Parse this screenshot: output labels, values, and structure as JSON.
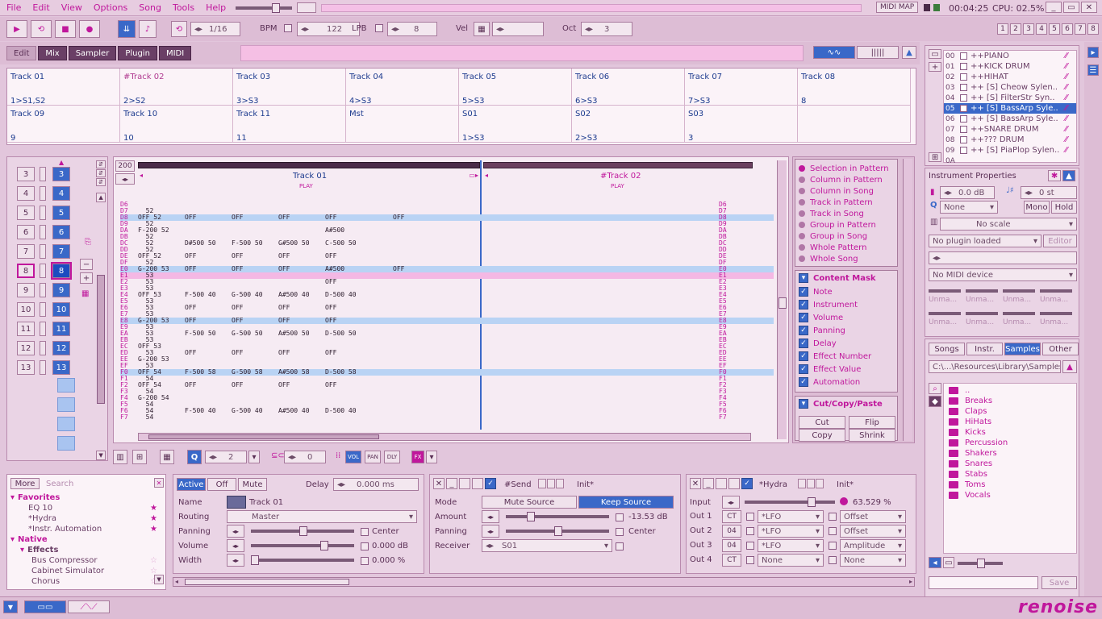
{
  "menu": [
    "File",
    "Edit",
    "View",
    "Options",
    "Song",
    "Tools",
    "Help"
  ],
  "top": {
    "midi_map": "MIDI MAP",
    "time": "00:04:25",
    "cpu": "CPU: 02.5%"
  },
  "transport": {
    "quant": "1/16",
    "bpm_label": "BPM",
    "bpm": "122",
    "lpb_label": "LPB",
    "lpb": "8",
    "vel_label": "Vel",
    "oct_label": "Oct",
    "oct": "3",
    "edit_steps": [
      "1",
      "2",
      "3",
      "4",
      "5",
      "6",
      "7",
      "8"
    ]
  },
  "tabs": [
    "Edit",
    "Mix",
    "Sampler",
    "Plugin",
    "MIDI"
  ],
  "instruments": [
    {
      "num": "00",
      "name": "++PIANO"
    },
    {
      "num": "01",
      "name": "++KICK DRUM"
    },
    {
      "num": "02",
      "name": "++HIHAT"
    },
    {
      "num": "03",
      "name": "++ [S] Cheow Sylen.."
    },
    {
      "num": "04",
      "name": "++ [S] FilterStr Syn.."
    },
    {
      "num": "05",
      "name": "++ [S] BassArp Syle.."
    },
    {
      "num": "06",
      "name": "++ [S] BassArp Syle.."
    },
    {
      "num": "07",
      "name": "++SNARE DRUM"
    },
    {
      "num": "08",
      "name": "++??? DRUM"
    },
    {
      "num": "09",
      "name": "++ [S] PiaPlop Sylen.."
    },
    {
      "num": "0A",
      "name": ""
    }
  ],
  "grid": {
    "row1": [
      [
        "Track 01",
        "1>S1,S2"
      ],
      [
        "#Track 02",
        "2>S2"
      ],
      [
        "Track 03",
        "3>S3"
      ],
      [
        "Track 04",
        "4>S3"
      ],
      [
        "Track 05",
        "5>S3"
      ],
      [
        "Track 06",
        "6>S3"
      ],
      [
        "Track 07",
        "7>S3"
      ],
      [
        "Track 08",
        "8"
      ]
    ],
    "row2": [
      [
        "Track 09",
        "9"
      ],
      [
        "Track 10",
        "10"
      ],
      [
        "Track 11",
        "11"
      ],
      [
        "Mst",
        ""
      ],
      [
        "S01",
        "1>S3"
      ],
      [
        "S02",
        "2>S3"
      ],
      [
        "S03",
        "3"
      ],
      [
        "",
        ""
      ]
    ]
  },
  "seq": {
    "left": [
      "3",
      "4",
      "5",
      "6",
      "7",
      "8",
      "9",
      "10",
      "11",
      "12",
      "13"
    ],
    "right": [
      "3",
      "4",
      "5",
      "6",
      "7",
      "8",
      "9",
      "10",
      "11",
      "12",
      "13"
    ],
    "len": "200"
  },
  "pattern": {
    "track1": "Track 01",
    "track2": "#Track 02",
    "play": "PLAY",
    "rows": [
      [
        "D6",
        "",
        "",
        "",
        "",
        "",
        "",
        "D6"
      ],
      [
        "D7",
        "  52",
        "",
        "",
        "",
        "",
        "",
        "D7"
      ],
      [
        "D8",
        "OFF 52",
        "OFF",
        "OFF",
        "OFF",
        "OFF",
        "OFF",
        "D8"
      ],
      [
        "D9",
        "  52",
        "",
        "",
        "",
        "",
        "",
        "D9"
      ],
      [
        "DA",
        "F-200 52",
        "",
        "",
        "",
        "A#500",
        "",
        "DA"
      ],
      [
        "DB",
        "  52",
        "",
        "",
        "",
        "",
        "",
        "DB"
      ],
      [
        "DC",
        "  52",
        "D#500 50",
        "F-500 50",
        "G#500 50",
        "C-500 50",
        "",
        "DC"
      ],
      [
        "DD",
        "  52",
        "",
        "",
        "",
        "",
        "",
        "DD"
      ],
      [
        "DE",
        "OFF 52",
        "OFF",
        "OFF",
        "OFF",
        "OFF",
        "",
        "DE"
      ],
      [
        "DF",
        "  52",
        "",
        "",
        "",
        "",
        "",
        "DF"
      ],
      [
        "E0",
        "G-200 53",
        "OFF",
        "OFF",
        "OFF",
        "A#500",
        "OFF",
        "E0"
      ],
      [
        "E1",
        "  53",
        "",
        "",
        "",
        "",
        "",
        "E1"
      ],
      [
        "E2",
        "  53",
        "",
        "",
        "",
        "OFF",
        "",
        "E2"
      ],
      [
        "E3",
        "  53",
        "",
        "",
        "",
        "",
        "",
        "E3"
      ],
      [
        "E4",
        "OFF 53",
        "F-500 40",
        "G-500 40",
        "A#500 40",
        "D-500 40",
        "",
        "E4"
      ],
      [
        "E5",
        "  53",
        "",
        "",
        "",
        "",
        "",
        "E5"
      ],
      [
        "E6",
        "  53",
        "OFF",
        "OFF",
        "OFF",
        "OFF",
        "",
        "E6"
      ],
      [
        "E7",
        "  53",
        "",
        "",
        "",
        "",
        "",
        "E7"
      ],
      [
        "E8",
        "G-200 53",
        "OFF",
        "OFF",
        "OFF",
        "OFF",
        "",
        "E8"
      ],
      [
        "E9",
        "  53",
        "",
        "",
        "",
        "",
        "",
        "E9"
      ],
      [
        "EA",
        "  53",
        "F-500 50",
        "G-500 50",
        "A#500 50",
        "D-500 50",
        "",
        "EA"
      ],
      [
        "EB",
        "  53",
        "",
        "",
        "",
        "",
        "",
        "EB"
      ],
      [
        "EC",
        "OFF 53",
        "",
        "",
        "",
        "",
        "",
        "EC"
      ],
      [
        "ED",
        "  53",
        "OFF",
        "OFF",
        "OFF",
        "OFF",
        "",
        "ED"
      ],
      [
        "EE",
        "G-200 53",
        "",
        "",
        "",
        "",
        "",
        "EE"
      ],
      [
        "EF",
        "  53",
        "",
        "",
        "",
        "",
        "",
        "EF"
      ],
      [
        "F0",
        "OFF 54",
        "F-500 58",
        "G-500 58",
        "A#500 58",
        "D-500 58",
        "",
        "F0"
      ],
      [
        "F1",
        "  54",
        "",
        "",
        "",
        "",
        "",
        "F1"
      ],
      [
        "F2",
        "OFF 54",
        "OFF",
        "OFF",
        "OFF",
        "OFF",
        "",
        "F2"
      ],
      [
        "F3",
        "  54",
        "",
        "",
        "",
        "",
        "",
        "F3"
      ],
      [
        "F4",
        "G-200 54",
        "",
        "",
        "",
        "",
        "",
        "F4"
      ],
      [
        "F5",
        "  54",
        "",
        "",
        "",
        "",
        "",
        "F5"
      ],
      [
        "F6",
        "  54",
        "F-500 40",
        "G-500 40",
        "A#500 40",
        "D-500 40",
        "",
        "F6"
      ],
      [
        "F7",
        "  54",
        "",
        "",
        "",
        "",
        "",
        "F7"
      ]
    ]
  },
  "scope": [
    "Selection in Pattern",
    "Column in Pattern",
    "Column in Song",
    "Track in Pattern",
    "Track in Song",
    "Group in Pattern",
    "Group in Song",
    "Whole Pattern",
    "Whole Song"
  ],
  "mask": {
    "title": "Content Mask",
    "items": [
      "Note",
      "Instrument",
      "Volume",
      "Panning",
      "Delay",
      "Effect Number",
      "Effect Value",
      "Automation"
    ]
  },
  "ccp": {
    "title": "Cut/Copy/Paste",
    "cut": "Cut",
    "flip": "Flip",
    "copy": "Copy",
    "shrink": "Shrink"
  },
  "instprops": {
    "title": "Instrument Properties",
    "vol": "0.0 dB",
    "transp": "0 st",
    "quant": "None",
    "mono": "Mono",
    "hold": "Hold",
    "scale": "No scale",
    "plugin": "No plugin loaded",
    "editor": "Editor",
    "midi": "No MIDI device",
    "unmapped": "Unma..."
  },
  "browser": {
    "tabs": [
      "Songs",
      "Instr.",
      "Samples",
      "Other"
    ],
    "path": "C:\\...\\Resources\\Library\\Samples\\",
    "folders": [
      "..",
      "Breaks",
      "Claps",
      "HiHats",
      "Kicks",
      "Percussion",
      "Shakers",
      "Snares",
      "Stabs",
      "Toms",
      "Vocals"
    ],
    "save": "Save"
  },
  "pattbar": {
    "q": "2",
    "fx": "0",
    "vol": "VOL",
    "pan": "PAN",
    "dly": "DLY",
    "fxl": "FX"
  },
  "dsp": {
    "more": "More",
    "search": "Search",
    "tree": [
      {
        "t": "Favorites",
        "lv": 0
      },
      {
        "t": "EQ 10",
        "lv": 1,
        "star": true
      },
      {
        "t": "*Hydra",
        "lv": 1,
        "star": true
      },
      {
        "t": "*Instr. Automation",
        "lv": 1,
        "star": true
      },
      {
        "t": "Native",
        "lv": 0
      },
      {
        "t": "Effects",
        "lv": 1
      },
      {
        "t": "Bus Compressor",
        "lv": 2
      },
      {
        "t": "Cabinet Simulator",
        "lv": 2
      },
      {
        "t": "Chorus",
        "lv": 2
      }
    ]
  },
  "trackdsp": {
    "active": "Active",
    "off": "Off",
    "mute": "Mute",
    "delay_label": "Delay",
    "delay": "0.000 ms",
    "name_label": "Name",
    "name": "Track 01",
    "routing_label": "Routing",
    "routing": "Master",
    "panning_label": "Panning",
    "center": "Center",
    "volume_label": "Volume",
    "volume": "0.000 dB",
    "width_label": "Width",
    "width": "0.000 %"
  },
  "send": {
    "title": "#Send",
    "init": "Init*",
    "mode_label": "Mode",
    "mute_src": "Mute Source",
    "keep_src": "Keep Source",
    "amount_label": "Amount",
    "amount": "-13.53 dB",
    "panning_label": "Panning",
    "center": "Center",
    "receiver_label": "Receiver",
    "receiver": "S01"
  },
  "hydra": {
    "title": "*Hydra",
    "init": "Init*",
    "input_label": "Input",
    "input": "63.529 %",
    "outs": [
      {
        "l": "Out 1",
        "ct": "CT",
        "dev": "*LFO",
        "par": "Offset"
      },
      {
        "l": "Out 2",
        "ct": "04",
        "dev": "*LFO",
        "par": "Offset"
      },
      {
        "l": "Out 3",
        "ct": "04",
        "dev": "*LFO",
        "par": "Amplitude"
      },
      {
        "l": "Out 4",
        "ct": "CT",
        "dev": "None",
        "par": "None"
      }
    ]
  },
  "logo": "renoise"
}
